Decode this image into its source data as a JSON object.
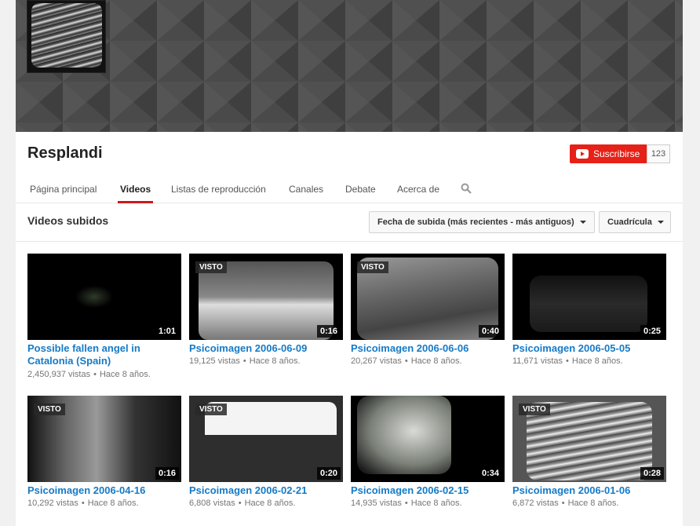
{
  "channel": {
    "name": "Resplandi",
    "subscribe_label": "Suscribirse",
    "subscriber_count": "123"
  },
  "tabs": [
    {
      "label": "Página principal"
    },
    {
      "label": "Videos"
    },
    {
      "label": "Listas de reproducción"
    },
    {
      "label": "Canales"
    },
    {
      "label": "Debate"
    },
    {
      "label": "Acerca de"
    }
  ],
  "section": {
    "title": "Videos subidos",
    "sort_label": "Fecha de subida (más recientes - más antiguos)",
    "view_label": "Cuadrícula"
  },
  "videos": [
    {
      "title": "Possible fallen angel in Catalonia (Spain)",
      "duration": "1:01",
      "views": "2,450,937 vistas",
      "age": "Hace 8 años.",
      "watched": ""
    },
    {
      "title": "Psicoimagen 2006-06-09",
      "duration": "0:16",
      "views": "19,125 vistas",
      "age": "Hace 8 años.",
      "watched": "VISTO"
    },
    {
      "title": "Psicoimagen 2006-06-06",
      "duration": "0:40",
      "views": "20,267 vistas",
      "age": "Hace 8 años.",
      "watched": "VISTO"
    },
    {
      "title": "Psicoimagen 2006-05-05",
      "duration": "0:25",
      "views": "11,671 vistas",
      "age": "Hace 8 años.",
      "watched": ""
    },
    {
      "title": "Psicoimagen 2006-04-16",
      "duration": "0:16",
      "views": "10,292 vistas",
      "age": "Hace 8 años.",
      "watched": "VISTO"
    },
    {
      "title": "Psicoimagen 2006-02-21",
      "duration": "0:20",
      "views": "6,808 vistas",
      "age": "Hace 8 años.",
      "watched": "VISTO"
    },
    {
      "title": "Psicoimagen 2006-02-15",
      "duration": "0:34",
      "views": "14,935 vistas",
      "age": "Hace 8 años.",
      "watched": ""
    },
    {
      "title": "Psicoimagen 2006-01-06",
      "duration": "0:28",
      "views": "6,872 vistas",
      "age": "Hace 8 años.",
      "watched": "VISTO"
    }
  ],
  "colors": {
    "accent": "#cc181e",
    "subscribe": "#e62117",
    "link": "#167ac6"
  }
}
